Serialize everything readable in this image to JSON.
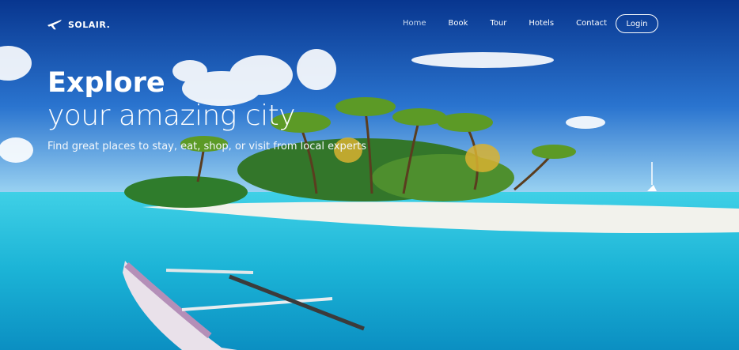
{
  "brand": {
    "name": "SOLAIR.",
    "logo_icon": "airplane-icon"
  },
  "nav": {
    "items": [
      {
        "label": "Home",
        "active": true
      },
      {
        "label": "Book",
        "active": false
      },
      {
        "label": "Tour",
        "active": false
      },
      {
        "label": "Hotels",
        "active": false
      },
      {
        "label": "Contact",
        "active": false
      }
    ],
    "login_label": "Login"
  },
  "hero": {
    "headline_bold": "Explore",
    "headline_light": "your amazing city",
    "subtitle": "Find great places to stay, eat, shop, or visit from local experts"
  },
  "colors": {
    "sky": "#1a5bb8",
    "water": "#0fb2d3",
    "sand": "#f1f1ec",
    "text": "#ffffff"
  }
}
